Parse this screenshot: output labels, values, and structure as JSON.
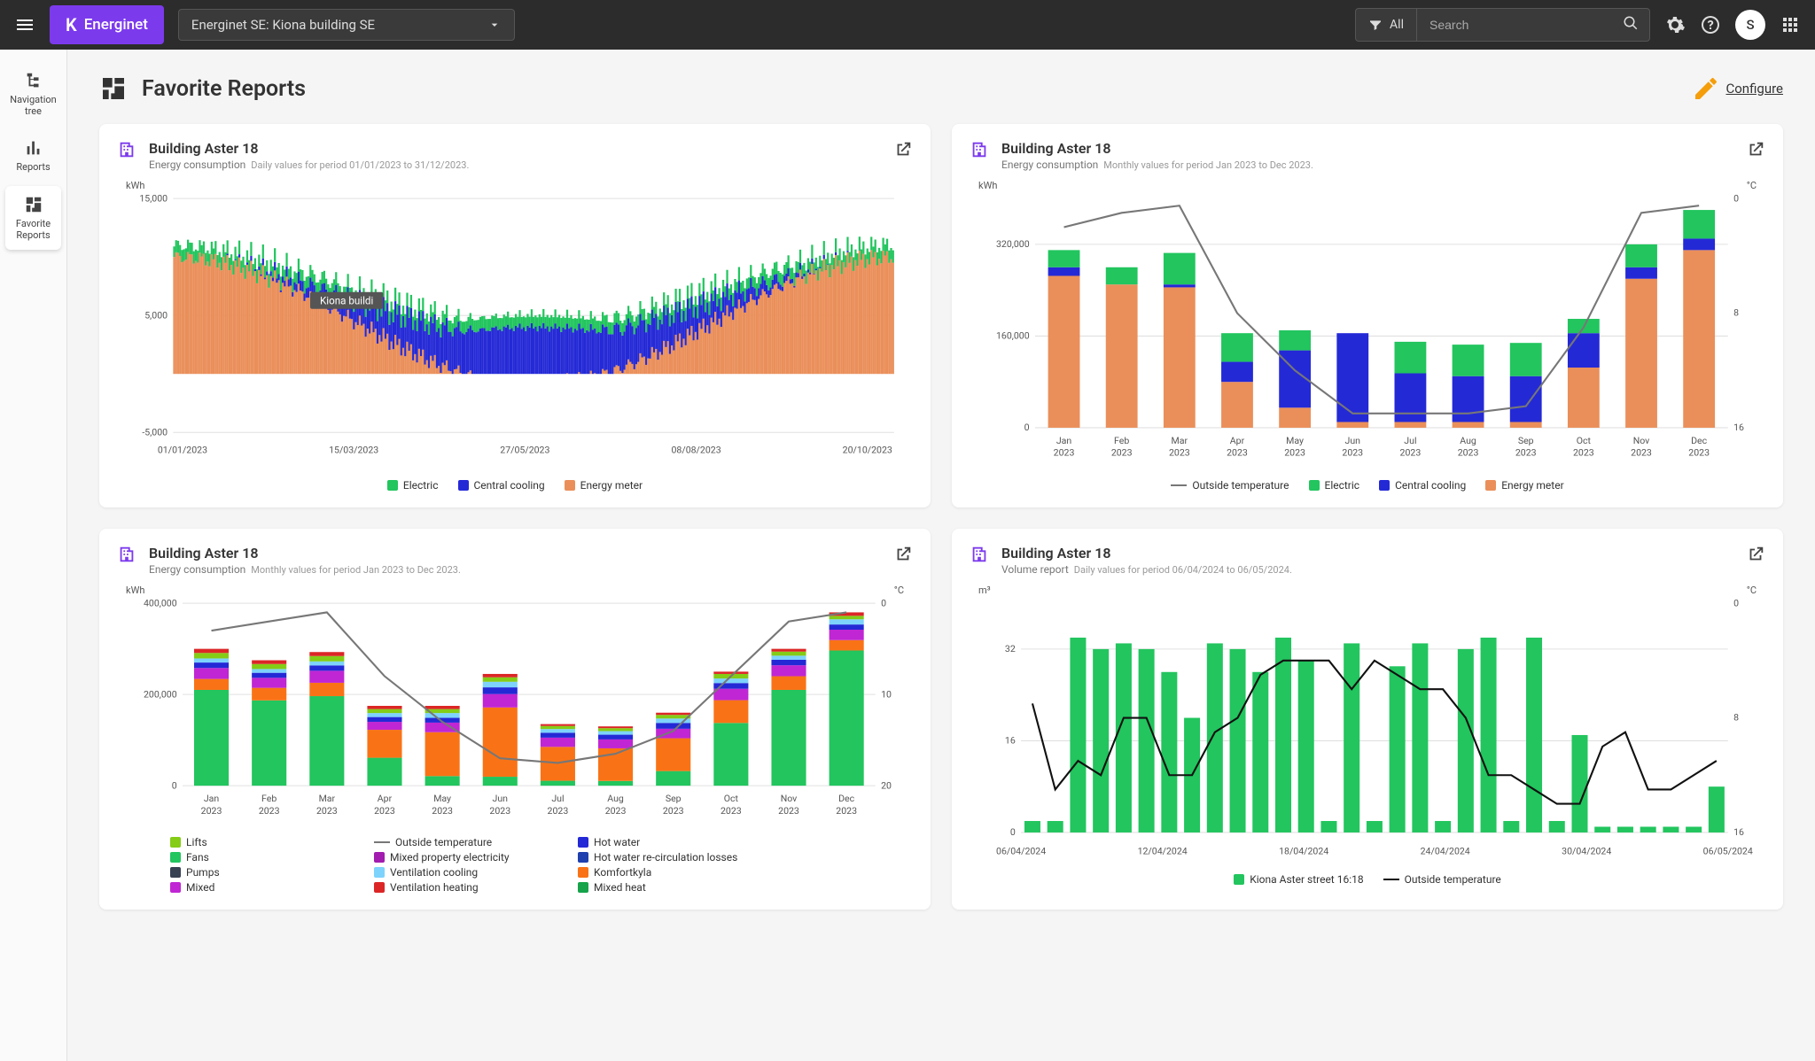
{
  "topbar": {
    "brand": "Energinet",
    "building_selector": "Energinet SE: Kiona building SE",
    "filter_label": "All",
    "search_placeholder": "Search",
    "avatar_initial": "S"
  },
  "siderail": {
    "items": [
      {
        "label": "Navigation tree"
      },
      {
        "label": "Reports"
      },
      {
        "label": "Favorite Reports"
      }
    ]
  },
  "page": {
    "title": "Favorite Reports",
    "configure": "Configure"
  },
  "cards": [
    {
      "title": "Building Aster 18",
      "subtitle": "Energy consumption",
      "period": "Daily values for period 01/01/2023 to 31/12/2023.",
      "y_label": "kWh"
    },
    {
      "title": "Building Aster 18",
      "subtitle": "Energy consumption",
      "period": "Monthly values for period Jan 2023 to Dec 2023.",
      "y_label": "kWh",
      "y_right_label": "°C"
    },
    {
      "title": "Building Aster 18",
      "subtitle": "Energy consumption",
      "period": "Monthly values for period Jan 2023 to Dec 2023.",
      "y_label": "kWh",
      "y_right_label": "°C"
    },
    {
      "title": "Building Aster 18",
      "subtitle": "Volume report",
      "period": "Daily values for period 06/04/2024 to 06/05/2024.",
      "y_label": "m³",
      "y_right_label": "°C"
    }
  ],
  "chart_data": [
    {
      "type": "bar",
      "stacked": true,
      "unit": "kWh",
      "ylim": [
        -5000,
        15000
      ],
      "y_ticks": [
        -5000,
        5000,
        15000
      ],
      "x_ticks": [
        "01/01/2023",
        "15/03/2023",
        "27/05/2023",
        "08/08/2023",
        "20/10/2023"
      ],
      "legend": [
        {
          "name": "Electric",
          "color": "#22c55e"
        },
        {
          "name": "Central cooling",
          "color": "#2429d6"
        },
        {
          "name": "Energy meter",
          "color": "#ea8f5a"
        }
      ],
      "series_desc": "365 daily stacked bars. Approximate total daily kWh: ~12000–15000 Jan–Mar, dropping to ~1000–4000 May–Sep (higher central-cooling blue share), rising back to ~14000–17000 Nov–Dec. Energy meter (orange) is the dominant base layer in winter; central cooling (blue) dominates in summer valleys; electric (green) is a thin top layer.",
      "tooltip_sample": "Kiona buildi"
    },
    {
      "type": "bar",
      "stacked": true,
      "unit": "kWh",
      "ylim": [
        0,
        400000
      ],
      "y_ticks": [
        0,
        160000,
        320000
      ],
      "y2_ticks": [
        0,
        8,
        16
      ],
      "y2_unit": "°C",
      "categories": [
        [
          "Jan",
          "2023"
        ],
        [
          "Feb",
          "2023"
        ],
        [
          "Mar",
          "2023"
        ],
        [
          "Apr",
          "2023"
        ],
        [
          "May",
          "2023"
        ],
        [
          "Jun",
          "2023"
        ],
        [
          "Jul",
          "2023"
        ],
        [
          "Aug",
          "2023"
        ],
        [
          "Sep",
          "2023"
        ],
        [
          "Oct",
          "2023"
        ],
        [
          "Nov",
          "2023"
        ],
        [
          "Dec",
          "2023"
        ]
      ],
      "series": [
        {
          "name": "Energy meter",
          "color": "#ea8f5a",
          "values": [
            265000,
            250000,
            245000,
            80000,
            35000,
            10000,
            10000,
            10000,
            10000,
            105000,
            260000,
            310000
          ]
        },
        {
          "name": "Central cooling",
          "color": "#2429d6",
          "values": [
            15000,
            0,
            5000,
            35000,
            100000,
            155000,
            85000,
            80000,
            80000,
            60000,
            20000,
            20000
          ]
        },
        {
          "name": "Electric",
          "color": "#22c55e",
          "values": [
            30000,
            30000,
            55000,
            50000,
            35000,
            0,
            55000,
            55000,
            58000,
            25000,
            40000,
            50000
          ]
        }
      ],
      "line_series": {
        "name": "Outside temperature",
        "color": "#777777",
        "values": [
          2,
          1,
          0.5,
          8,
          12,
          15,
          15,
          15,
          14.5,
          9,
          1,
          0.5
        ]
      },
      "legend": [
        {
          "name": "Outside temperature",
          "type": "line",
          "color": "#777777"
        },
        {
          "name": "Electric",
          "color": "#22c55e"
        },
        {
          "name": "Central cooling",
          "color": "#2429d6"
        },
        {
          "name": "Energy meter",
          "color": "#ea8f5a"
        }
      ]
    },
    {
      "type": "bar",
      "stacked": true,
      "unit": "kWh",
      "ylim": [
        0,
        400000
      ],
      "y_ticks": [
        0,
        200000,
        400000
      ],
      "y2_ticks": [
        0,
        10,
        20
      ],
      "y2_unit": "°C",
      "categories": [
        [
          "Jan",
          "2023"
        ],
        [
          "Feb",
          "2023"
        ],
        [
          "Mar",
          "2023"
        ],
        [
          "Apr",
          "2023"
        ],
        [
          "May",
          "2023"
        ],
        [
          "Jun",
          "2023"
        ],
        [
          "Jul",
          "2023"
        ],
        [
          "Aug",
          "2023"
        ],
        [
          "Sep",
          "2023"
        ],
        [
          "Oct",
          "2023"
        ],
        [
          "Nov",
          "2023"
        ],
        [
          "Dec",
          "2023"
        ]
      ],
      "series_totals": [
        300000,
        275000,
        293000,
        175000,
        175000,
        245000,
        135000,
        130000,
        160000,
        250000,
        300000,
        380000
      ],
      "legend": [
        {
          "name": "Lifts",
          "color": "#84cc16"
        },
        {
          "name": "Fans",
          "color": "#22c55e"
        },
        {
          "name": "Pumps",
          "color": "#374151"
        },
        {
          "name": "Mixed",
          "color": "#c026d3"
        },
        {
          "name": "Outside temperature",
          "type": "line",
          "color": "#777777"
        },
        {
          "name": "Mixed property electricity",
          "color": "#a21caf"
        },
        {
          "name": "Ventilation cooling",
          "color": "#7dd3fc"
        },
        {
          "name": "Ventilation heating",
          "color": "#dc2626"
        },
        {
          "name": "Hot water",
          "color": "#2429d6"
        },
        {
          "name": "Hot water re-circulation losses",
          "color": "#1e40af"
        },
        {
          "name": "Komfortkyla",
          "color": "#f97316"
        },
        {
          "name": "Mixed heat",
          "color": "#16a34a"
        }
      ],
      "line_series": {
        "name": "Outside temperature",
        "color": "#777777",
        "values": [
          3,
          2,
          1,
          8,
          13,
          17,
          17.5,
          16.5,
          14,
          8,
          2,
          1
        ]
      }
    },
    {
      "type": "bar",
      "unit": "m³",
      "ylim": [
        0,
        40
      ],
      "y_ticks": [
        0,
        16,
        32
      ],
      "y2_ticks": [
        0,
        8,
        16
      ],
      "y2_unit": "°C",
      "x_ticks": [
        "06/04/2024",
        "12/04/2024",
        "18/04/2024",
        "24/04/2024",
        "30/04/2024",
        "06/05/2024"
      ],
      "series": [
        {
          "name": "Kiona Aster street 16:18",
          "color": "#22c55e",
          "values": [
            2,
            2,
            34,
            32,
            33,
            32,
            28,
            20,
            33,
            32,
            28,
            34,
            30,
            2,
            33,
            2,
            29,
            33,
            2,
            32,
            34,
            2,
            34,
            2,
            17,
            1,
            1,
            1,
            1,
            1,
            8
          ]
        }
      ],
      "line_series": {
        "name": "Outside temperature",
        "color": "#111111",
        "values": [
          7,
          13,
          11,
          12,
          8,
          8,
          12,
          12,
          9,
          8,
          5,
          4,
          4,
          4,
          6,
          4,
          5,
          6,
          6,
          8,
          12,
          12,
          13,
          14,
          14,
          10,
          9,
          13,
          13,
          12,
          11
        ]
      },
      "legend": [
        {
          "name": "Kiona Aster street 16:18",
          "color": "#22c55e"
        },
        {
          "name": "Outside temperature",
          "type": "line",
          "color": "#111111"
        }
      ]
    }
  ]
}
